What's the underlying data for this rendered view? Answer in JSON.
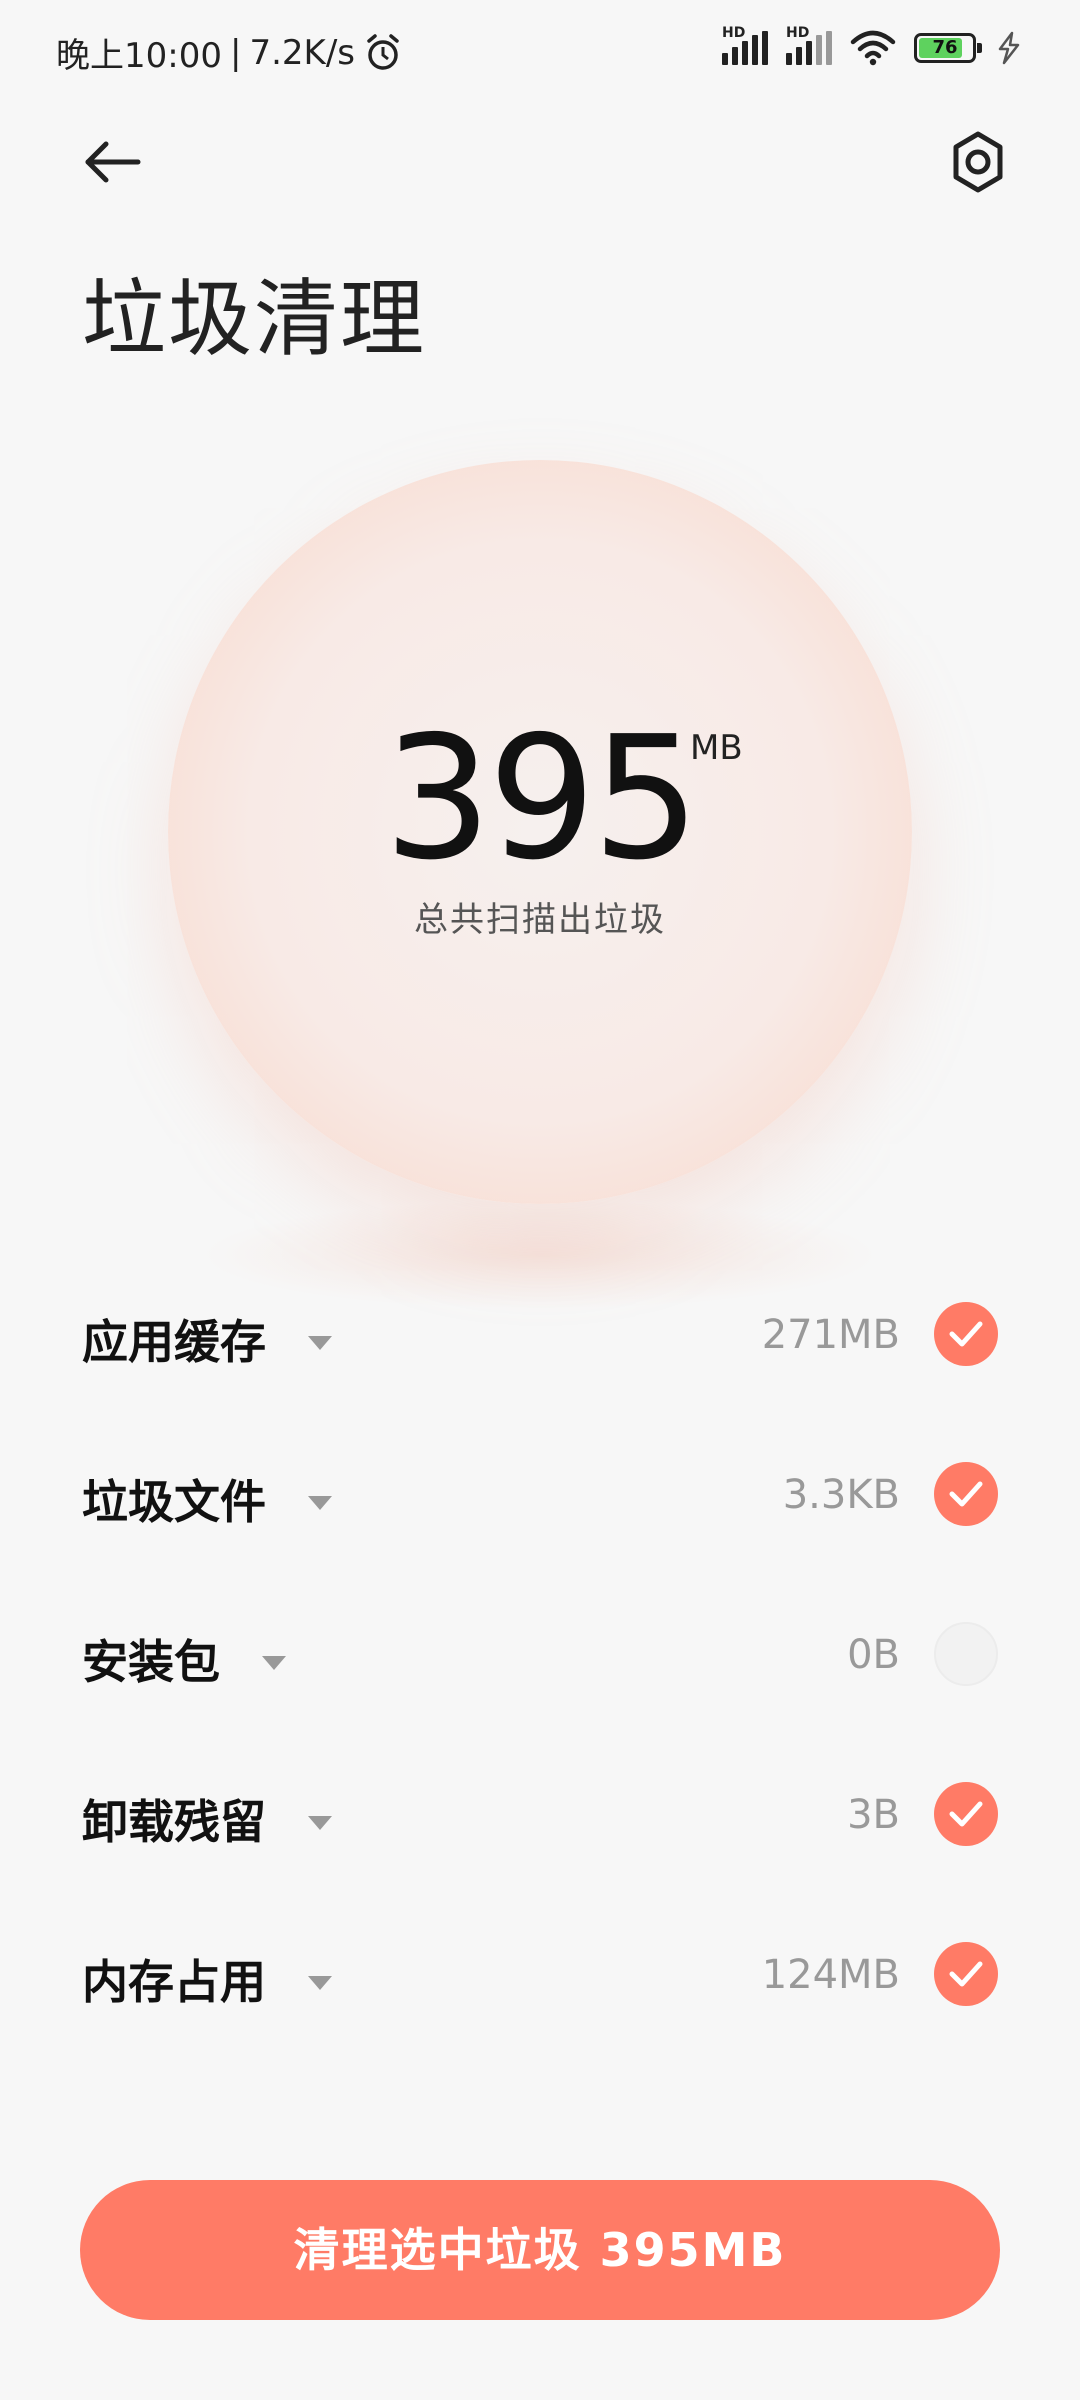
{
  "status_bar": {
    "time": "晚上10:00",
    "speed": "7.2K/s",
    "separator": "|",
    "network_label": "HD",
    "battery_level": "76"
  },
  "header": {
    "title": "垃圾清理"
  },
  "summary": {
    "total_value": "395",
    "total_unit": "MB",
    "caption": "总共扫描出垃圾"
  },
  "items": [
    {
      "label": "应用缓存",
      "size": "271MB",
      "checked": true
    },
    {
      "label": "垃圾文件",
      "size": "3.3KB",
      "checked": true
    },
    {
      "label": "安装包",
      "size": "0B",
      "checked": false
    },
    {
      "label": "卸载残留",
      "size": "3B",
      "checked": true
    },
    {
      "label": "内存占用",
      "size": "124MB",
      "checked": true
    }
  ],
  "action": {
    "clean_label": "清理选中垃圾 395MB"
  },
  "colors": {
    "accent": "#ff7b66",
    "background": "#f7f7f7"
  }
}
